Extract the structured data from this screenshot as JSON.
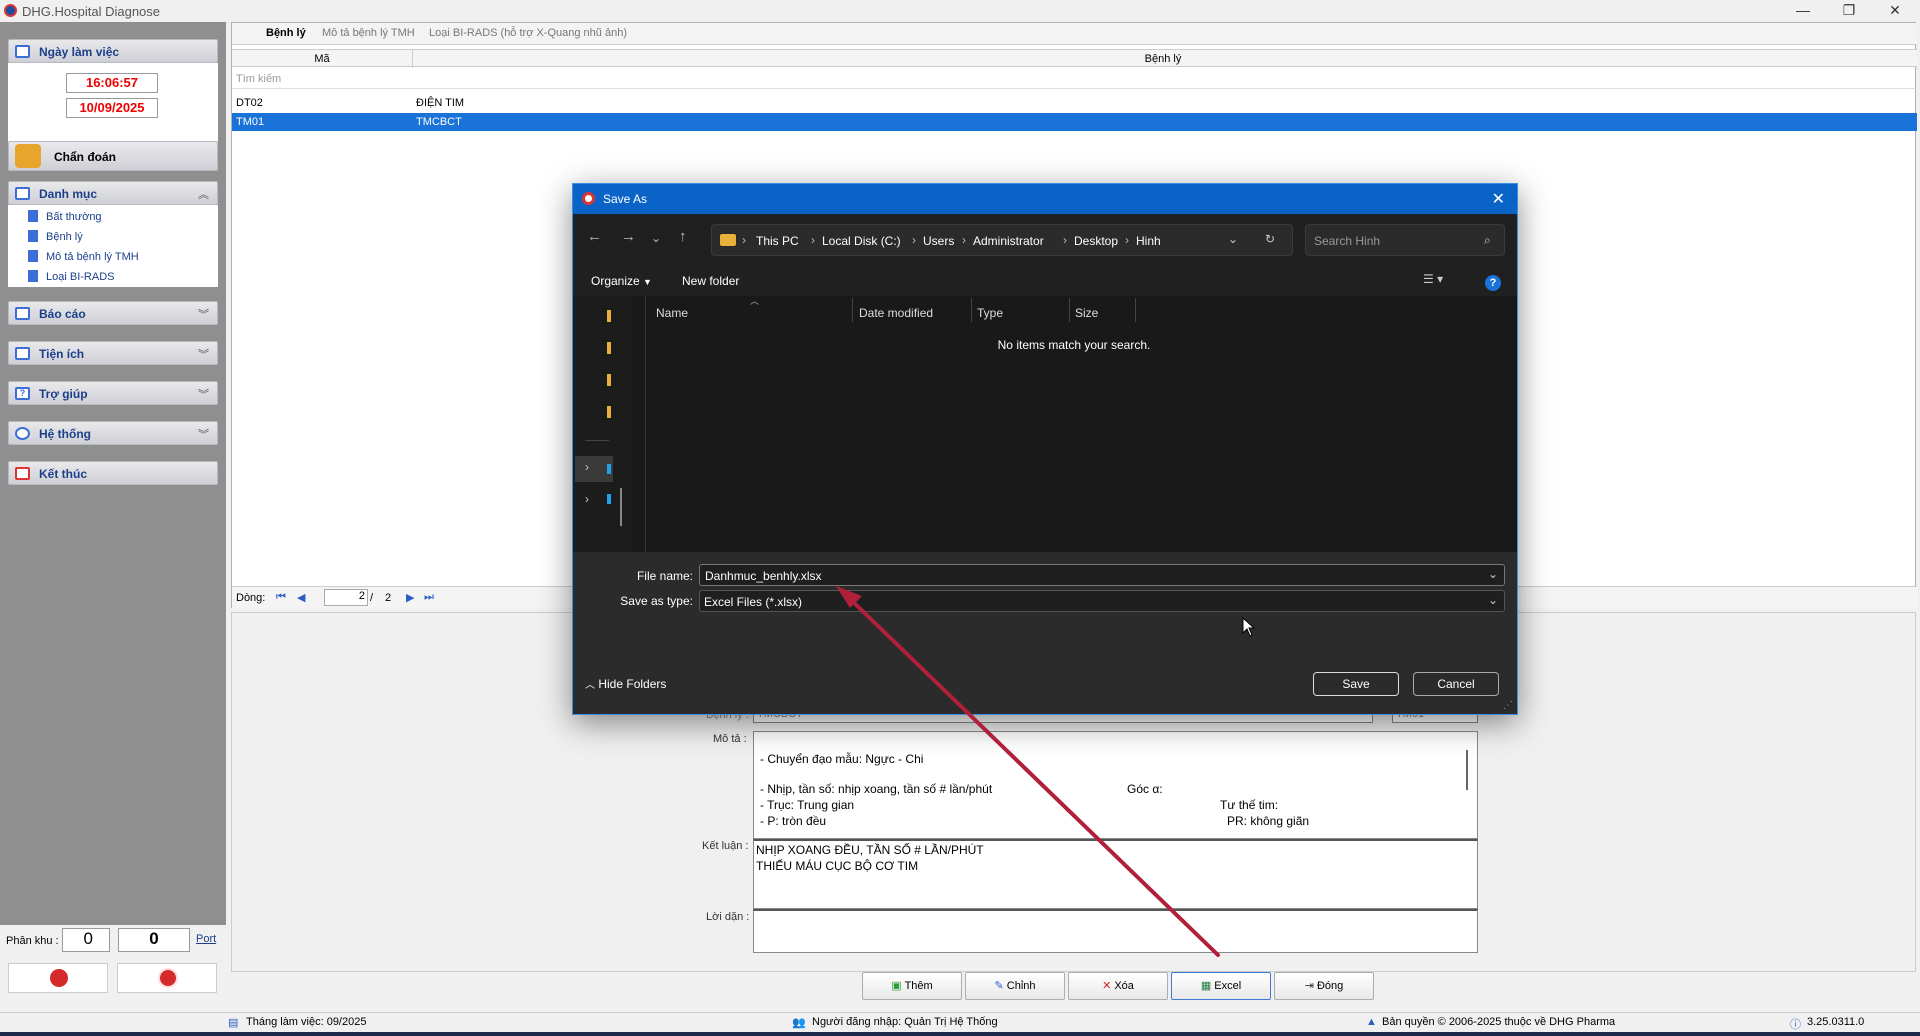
{
  "app": {
    "title": "DHG.Hospital Diagnose"
  },
  "sidebar": {
    "workday_label": "Ngày làm việc",
    "time": "16:06:57",
    "date": "10/09/2025",
    "diagnose_label": "Chẩn đoán",
    "catalog_label": "Danh mục",
    "catalog_items": [
      "Bất thường",
      "Bệnh lý",
      "Mô tả bệnh lý TMH",
      "Loại BI-RADS"
    ],
    "report_label": "Báo cáo",
    "utility_label": "Tiện ích",
    "help_label": "Trợ giúp",
    "system_label": "Hệ thống",
    "exit_label": "Kết thúc",
    "zone_label": "Phân khu :",
    "zone_value": "0",
    "zone_value2": "0",
    "port_label": "Port"
  },
  "tabs": [
    "Bệnh lý",
    "Mô tả bệnh lý TMH",
    "Loại BI-RADS (hỗ trợ X-Quang nhũ ảnh)"
  ],
  "grid": {
    "col_code": "Mã",
    "col_name": "Bệnh lý",
    "search_placeholder": "Tìm kiếm",
    "rows": [
      {
        "code": "DT02",
        "name": "ĐIỆN TIM"
      },
      {
        "code": "TM01",
        "name": "TMCBCT"
      }
    ],
    "pager_label": "Dòng:",
    "pager_current": "2",
    "pager_sep": "/",
    "pager_total": "2"
  },
  "detail": {
    "benhly_label": "Bệnh lý :",
    "benhly_value": "TMCBCT",
    "code_value": "TM01",
    "mota_label": "Mô tả :",
    "mota_lines": [
      "- Chuyển đạo mẫu:  Ngực - Chi",
      "- Nhịp, tần số:   nhịp xoang, tần số #  lần/phút",
      "- Trục:        Trung gian",
      "- P:    tròn đều"
    ],
    "mota_right": [
      "Góc α:",
      "Tư thế tim:",
      "PR: không giãn"
    ],
    "ketluan_label": "Kết luận :",
    "ketluan_lines": [
      "NHỊP XOANG ĐỀU, TẦN SỐ #  LẦN/PHÚT",
      "THIẾU MÁU CỤC BỘ CƠ TIM"
    ],
    "loidan_label": "Lời dặn :"
  },
  "buttons": {
    "add": "Thêm",
    "edit": "Chỉnh",
    "delete": "Xóa",
    "excel": "Excel",
    "close": "Đóng"
  },
  "status": {
    "month": "Tháng làm việc: 09/2025",
    "user": "Người đăng nhập: Quản Trị Hệ Thống",
    "copyright": "Bản quyền © 2006-2025 thuộc về DHG Pharma",
    "version": "3.25.0311.0"
  },
  "dialog": {
    "title": "Save As",
    "path": [
      "This PC",
      "Local Disk (C:)",
      "Users",
      "Administrator",
      "Desktop",
      "Hinh"
    ],
    "search_placeholder": "Search Hinh",
    "organize": "Organize",
    "new_folder": "New folder",
    "columns": [
      "Name",
      "Date modified",
      "Type",
      "Size"
    ],
    "empty_msg": "No items match your search.",
    "filename_label": "File name:",
    "filename_value": "Danhmuc_benhly.xlsx",
    "type_label": "Save as type:",
    "type_value": "Excel Files (*.xlsx)",
    "hide_folders": "Hide Folders",
    "save": "Save",
    "cancel": "Cancel"
  },
  "colors": {
    "accent": "#0a64c8",
    "selection": "#1a73d9",
    "arrow": "#b0203a"
  }
}
